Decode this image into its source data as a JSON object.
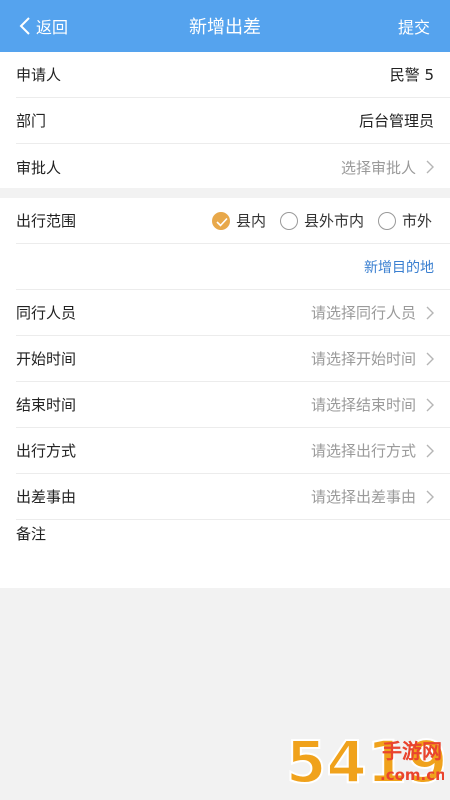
{
  "nav": {
    "back": "返回",
    "title": "新增出差",
    "submit": "提交"
  },
  "applicant": {
    "label": "申请人",
    "value": "民警 5"
  },
  "department": {
    "label": "部门",
    "value": "后台管理员"
  },
  "approver": {
    "label": "审批人",
    "placeholder": "选择审批人"
  },
  "range": {
    "label": "出行范围",
    "options": [
      {
        "label": "县内",
        "selected": true
      },
      {
        "label": "县外市内",
        "selected": false
      },
      {
        "label": "市外",
        "selected": false
      }
    ]
  },
  "add_destination": "新增目的地",
  "companions": {
    "label": "同行人员",
    "placeholder": "请选择同行人员"
  },
  "start_time": {
    "label": "开始时间",
    "placeholder": "请选择开始时间"
  },
  "end_time": {
    "label": "结束时间",
    "placeholder": "请选择结束时间"
  },
  "travel_mode": {
    "label": "出行方式",
    "placeholder": "请选择出行方式"
  },
  "reason": {
    "label": "出差事由",
    "placeholder": "请选择出差事由"
  },
  "remark": {
    "label": "备注"
  },
  "watermark": {
    "site": "手游网",
    "domain": ".com.cn",
    "digits": "5419"
  },
  "colors": {
    "nav": "#55a3ee",
    "radio_on": "#e8a84a",
    "link": "#3a7fd0"
  }
}
